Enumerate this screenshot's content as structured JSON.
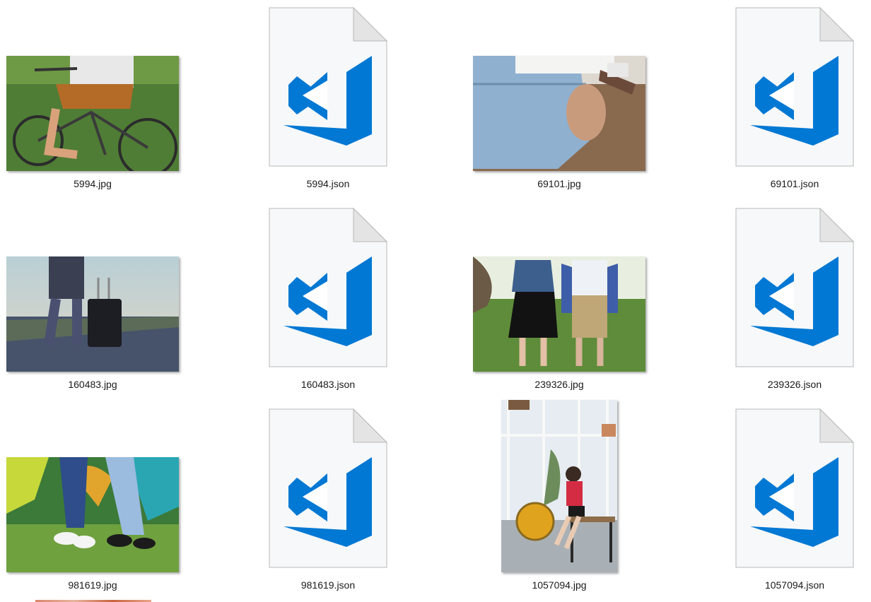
{
  "files": [
    {
      "name": "5994.jpg",
      "type": "photo",
      "scene": "bicycle"
    },
    {
      "name": "5994.json",
      "type": "json"
    },
    {
      "name": "69101.jpg",
      "type": "photo",
      "scene": "denim"
    },
    {
      "name": "69101.json",
      "type": "json"
    },
    {
      "name": "160483.jpg",
      "type": "photo",
      "scene": "road"
    },
    {
      "name": "160483.json",
      "type": "json"
    },
    {
      "name": "239326.jpg",
      "type": "photo",
      "scene": "couple"
    },
    {
      "name": "239326.json",
      "type": "json"
    },
    {
      "name": "981619.jpg",
      "type": "photo",
      "scene": "graffiti"
    },
    {
      "name": "981619.json",
      "type": "json"
    },
    {
      "name": "1057094.jpg",
      "type": "photo",
      "scene": "cafe"
    },
    {
      "name": "1057094.json",
      "type": "json"
    }
  ],
  "icon": "vscode-file-icon",
  "colors": {
    "accent": "#0078d4",
    "label": "#1a1a1a",
    "page_bg": "#ffffff"
  }
}
